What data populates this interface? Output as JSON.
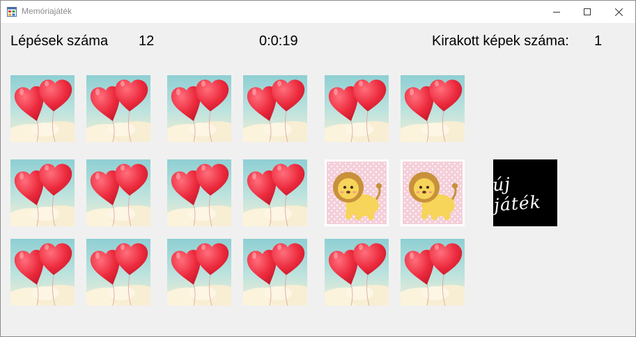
{
  "window": {
    "title": "Memóriajáték",
    "app_icon": "windows-form-icon",
    "controls": [
      "minimize-icon",
      "maximize-icon",
      "close-icon"
    ]
  },
  "header": {
    "steps_label": "Lépések száma",
    "steps_value": "12",
    "timer": "0:0:19",
    "solved_label": "Kirakott képek száma:",
    "solved_value": "1"
  },
  "board": {
    "rows": 3,
    "columns": 6,
    "card_back": "heart-balloons",
    "cards": [
      [
        "heart-balloons",
        "heart-balloons",
        "heart-balloons",
        "heart-balloons",
        "heart-balloons",
        "heart-balloons"
      ],
      [
        "heart-balloons",
        "heart-balloons",
        "heart-balloons",
        "heart-balloons",
        "lion",
        "lion"
      ],
      [
        "heart-balloons",
        "heart-balloons",
        "heart-balloons",
        "heart-balloons",
        "heart-balloons",
        "heart-balloons"
      ]
    ]
  },
  "new_game_button": {
    "label": "új játék"
  },
  "colors": {
    "window_bg": "#f0f0f0",
    "titlebar_bg": "#ffffff",
    "balloon_red": "#ef2b3f",
    "sky": "#9fd2d6",
    "lion_bg": "#f6d3dc",
    "lion_body": "#f7d45a",
    "lion_mane": "#c8913a"
  }
}
